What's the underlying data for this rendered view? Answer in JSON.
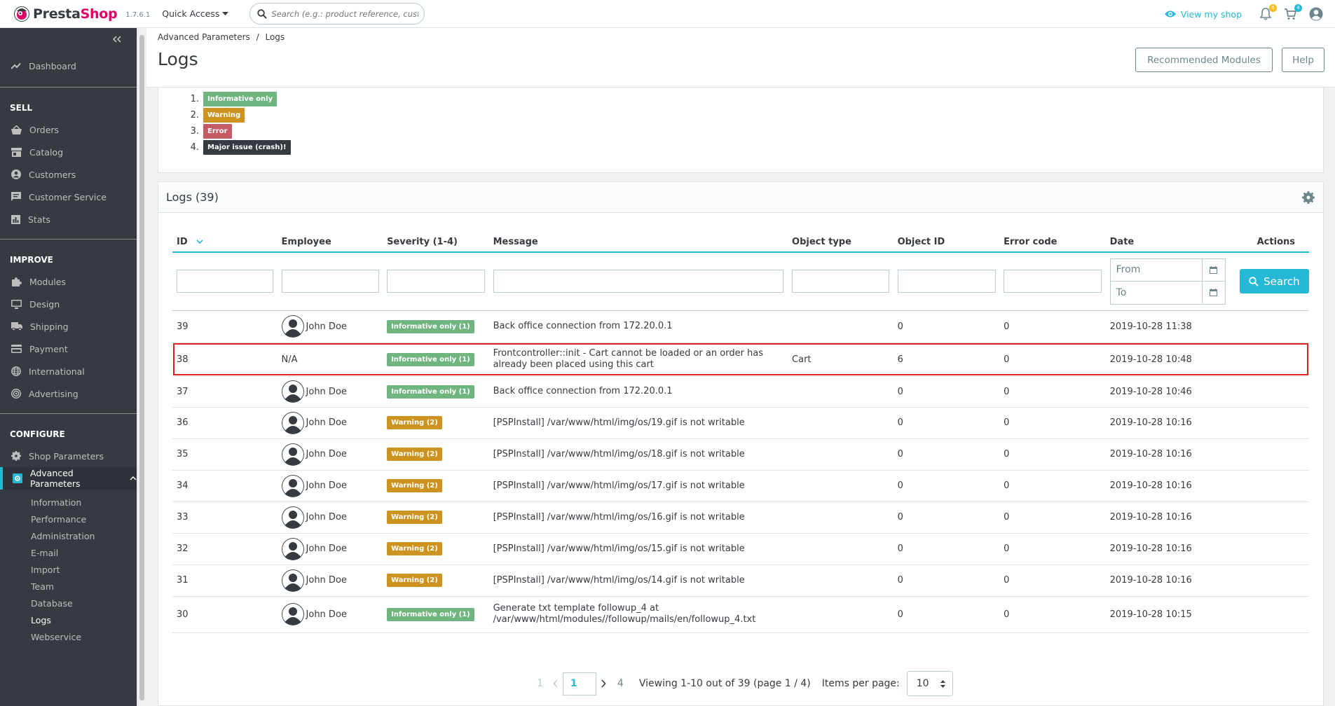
{
  "topbar": {
    "logo_main": "Presta",
    "logo_accent": "Shop",
    "version": "1.7.6.1",
    "quick_access": "Quick Access",
    "search_placeholder": "Search (e.g.: product reference, customer name…)",
    "view_shop": "View my shop",
    "notif_badge": "6",
    "cart_badge": "4"
  },
  "sidebar": {
    "dashboard": "Dashboard",
    "sections": {
      "sell": "SELL",
      "improve": "IMPROVE",
      "configure": "CONFIGURE"
    },
    "sell_items": [
      "Orders",
      "Catalog",
      "Customers",
      "Customer Service",
      "Stats"
    ],
    "improve_items": [
      "Modules",
      "Design",
      "Shipping",
      "Payment",
      "International",
      "Advertising"
    ],
    "configure_items": [
      "Shop Parameters",
      "Advanced Parameters"
    ],
    "sub_items": [
      "Information",
      "Performance",
      "Administration",
      "E-mail",
      "Import",
      "Team",
      "Database",
      "Logs",
      "Webservice"
    ],
    "current_sub": "Logs"
  },
  "header": {
    "breadcrumb_1": "Advanced Parameters",
    "breadcrumb_sep": "/",
    "breadcrumb_2": "Logs",
    "title": "Logs",
    "recommended": "Recommended Modules",
    "help": "Help"
  },
  "severity_legend": [
    {
      "num": "1.",
      "label": "Informative only"
    },
    {
      "num": "2.",
      "label": "Warning"
    },
    {
      "num": "3.",
      "label": "Error"
    },
    {
      "num": "4.",
      "label": "Major issue (crash)!"
    }
  ],
  "logs": {
    "title": "Logs (39)",
    "columns": {
      "id": "ID",
      "employee": "Employee",
      "severity": "Severity (1-4)",
      "message": "Message",
      "object_type": "Object type",
      "object_id": "Object ID",
      "error_code": "Error code",
      "date": "Date",
      "actions": "Actions"
    },
    "filter": {
      "from": "From",
      "to": "To",
      "search": "Search"
    },
    "rows": [
      {
        "id": "39",
        "employee": "John Doe",
        "severity": "Informative only (1)",
        "message": "Back office connection from 172.20.0.1",
        "object_type": "",
        "object_id": "0",
        "error_code": "0",
        "date": "2019-10-28 11:38"
      },
      {
        "id": "38",
        "employee": "N/A",
        "severity": "Informative only (1)",
        "message": "Frontcontroller::init - Cart cannot be loaded or an order has already been placed using this cart",
        "object_type": "Cart",
        "object_id": "6",
        "error_code": "0",
        "date": "2019-10-28 10:48"
      },
      {
        "id": "37",
        "employee": "John Doe",
        "severity": "Informative only (1)",
        "message": "Back office connection from 172.20.0.1",
        "object_type": "",
        "object_id": "0",
        "error_code": "0",
        "date": "2019-10-28 10:46"
      },
      {
        "id": "36",
        "employee": "John Doe",
        "severity": "Warning (2)",
        "message": "[PSPInstall] /var/www/html/img/os/19.gif is not writable",
        "object_type": "",
        "object_id": "0",
        "error_code": "0",
        "date": "2019-10-28 10:16"
      },
      {
        "id": "35",
        "employee": "John Doe",
        "severity": "Warning (2)",
        "message": "[PSPInstall] /var/www/html/img/os/18.gif is not writable",
        "object_type": "",
        "object_id": "0",
        "error_code": "0",
        "date": "2019-10-28 10:16"
      },
      {
        "id": "34",
        "employee": "John Doe",
        "severity": "Warning (2)",
        "message": "[PSPInstall] /var/www/html/img/os/17.gif is not writable",
        "object_type": "",
        "object_id": "0",
        "error_code": "0",
        "date": "2019-10-28 10:16"
      },
      {
        "id": "33",
        "employee": "John Doe",
        "severity": "Warning (2)",
        "message": "[PSPInstall] /var/www/html/img/os/16.gif is not writable",
        "object_type": "",
        "object_id": "0",
        "error_code": "0",
        "date": "2019-10-28 10:16"
      },
      {
        "id": "32",
        "employee": "John Doe",
        "severity": "Warning (2)",
        "message": "[PSPInstall] /var/www/html/img/os/15.gif is not writable",
        "object_type": "",
        "object_id": "0",
        "error_code": "0",
        "date": "2019-10-28 10:16"
      },
      {
        "id": "31",
        "employee": "John Doe",
        "severity": "Warning (2)",
        "message": "[PSPInstall] /var/www/html/img/os/14.gif is not writable",
        "object_type": "",
        "object_id": "0",
        "error_code": "0",
        "date": "2019-10-28 10:16"
      },
      {
        "id": "30",
        "employee": "John Doe",
        "severity": "Informative only (1)",
        "message": "Generate txt template followup_4 at /var/www/html/modules//followup/mails/en/followup_4.txt",
        "object_type": "",
        "object_id": "0",
        "error_code": "0",
        "date": "2019-10-28 10:15"
      }
    ]
  },
  "pagination": {
    "first": "1",
    "current": "1",
    "last": "4",
    "viewing": "Viewing 1-10 out of 39 (page 1 / 4)",
    "items_label": "Items per page:",
    "items_value": "10"
  },
  "colors": {
    "accent": "#25b9d7",
    "info": "#70b580",
    "warning": "#cd9321",
    "error": "#c45c67",
    "major": "#363a41",
    "highlight": "#e02020"
  }
}
